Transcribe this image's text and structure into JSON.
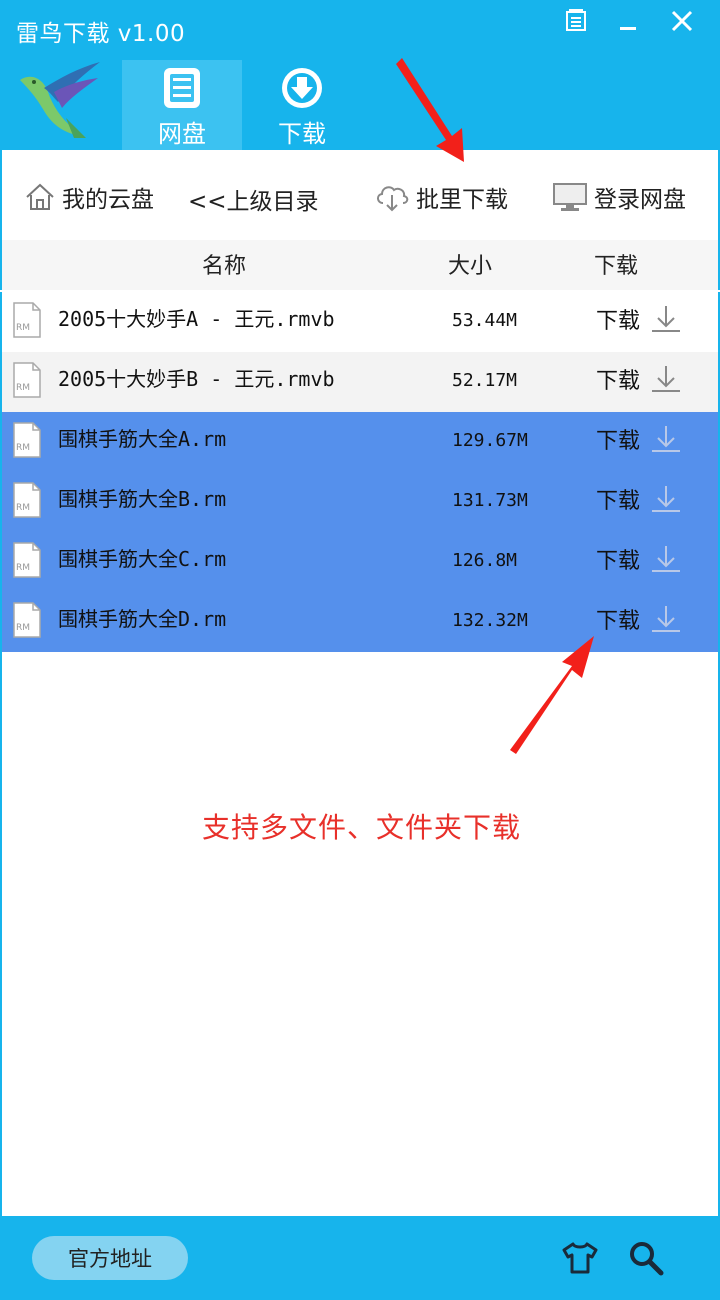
{
  "window": {
    "title": "雷鸟下载 v1.00"
  },
  "tabs": [
    {
      "label": "网盘",
      "icon": "disk-icon",
      "active": true
    },
    {
      "label": "下载",
      "icon": "download-circle-icon",
      "active": false
    }
  ],
  "toolbar": {
    "my_disk": "我的云盘",
    "parent_dir": "<<上级目录",
    "batch_download": "批里下载",
    "login_disk": "登录网盘"
  },
  "columns": {
    "name": "名称",
    "size": "大小",
    "download": "下载"
  },
  "files": [
    {
      "name": "2005十大妙手A - 王元.rmvb",
      "size": "53.44M",
      "action": "下载",
      "selected": false
    },
    {
      "name": "2005十大妙手B - 王元.rmvb",
      "size": "52.17M",
      "action": "下载",
      "selected": false
    },
    {
      "name": "围棋手筋大全A.rm",
      "size": "129.67M",
      "action": "下载",
      "selected": true
    },
    {
      "name": "围棋手筋大全B.rm",
      "size": "131.73M",
      "action": "下载",
      "selected": true
    },
    {
      "name": "围棋手筋大全C.rm",
      "size": "126.8M",
      "action": "下载",
      "selected": true
    },
    {
      "name": "围棋手筋大全D.rm",
      "size": "132.32M",
      "action": "下载",
      "selected": true
    }
  ],
  "annotation": {
    "text": "支持多文件、文件夹下载"
  },
  "footer": {
    "official_site": "官方地址"
  },
  "colors": {
    "titlebar": "#17b4ec",
    "selection": "#5590ec",
    "annotation": "#e8302a"
  }
}
